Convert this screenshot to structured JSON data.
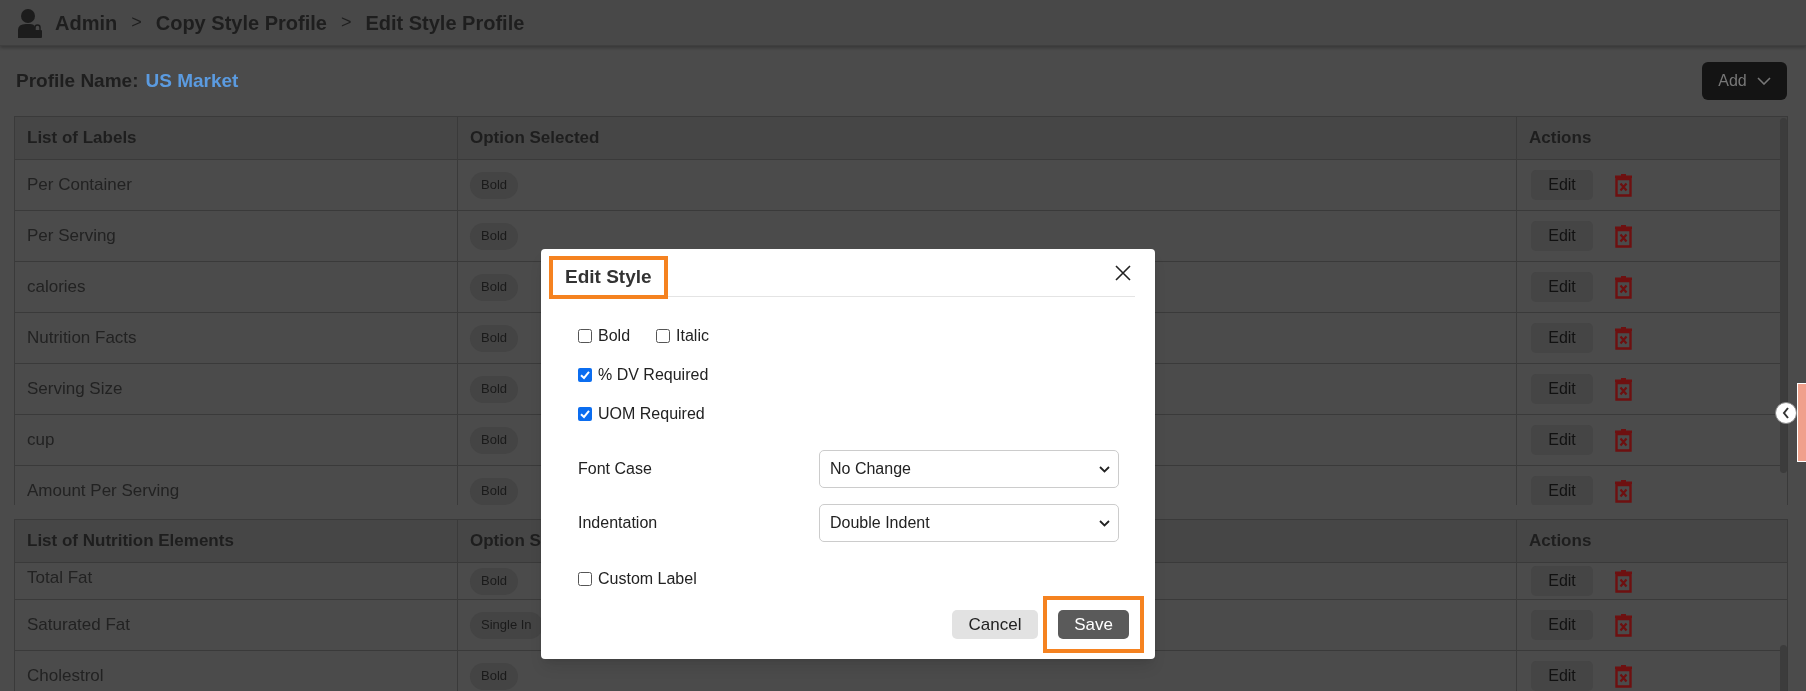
{
  "breadcrumb": [
    {
      "kind": "link",
      "text": "Admin"
    },
    {
      "kind": "separator",
      "text": ">"
    },
    {
      "kind": "link",
      "text": "Copy Style Profile"
    },
    {
      "kind": "separator",
      "text": ">"
    },
    {
      "kind": "current",
      "text": "Edit Style Profile"
    }
  ],
  "profile": {
    "label": "Profile Name:",
    "value": "US Market"
  },
  "add_button": {
    "label": "Add"
  },
  "labels_table": {
    "columns": [
      "List of Labels",
      "Option Selected",
      "Actions"
    ],
    "rows": [
      {
        "label": "Per Container",
        "options": [
          "Bold"
        ],
        "action": "Edit"
      },
      {
        "label": "Per Serving",
        "options": [
          "Bold"
        ],
        "action": "Edit"
      },
      {
        "label": "calories",
        "options": [
          "Bold"
        ],
        "action": "Edit"
      },
      {
        "label": "Nutrition Facts",
        "options": [
          "Bold"
        ],
        "action": "Edit"
      },
      {
        "label": "Serving Size",
        "options": [
          "Bold"
        ],
        "action": "Edit"
      },
      {
        "label": "cup",
        "options": [
          "Bold"
        ],
        "action": "Edit"
      },
      {
        "label": "Amount Per Serving",
        "options": [
          "Bold"
        ],
        "action": "Edit"
      }
    ]
  },
  "nutrition_table": {
    "columns": [
      "List of Nutrition Elements",
      "Option S",
      "Actions"
    ],
    "rows": [
      {
        "label": "Total Fat",
        "options": [
          "Bold"
        ],
        "action": "Edit"
      },
      {
        "label": "Saturated Fat",
        "options": [
          "Single In"
        ],
        "action": "Edit"
      },
      {
        "label": "Cholestrol",
        "options": [
          "Bold"
        ],
        "action": "Edit"
      }
    ]
  },
  "dialog": {
    "title": "Edit Style",
    "title_highlighted": true,
    "items": [
      {
        "kind": "checks",
        "options": [
          {
            "label": "Bold",
            "checked": false
          },
          {
            "label": "Italic",
            "checked": false
          }
        ]
      },
      {
        "kind": "checks",
        "options": [
          {
            "label": "% DV Required",
            "checked": true
          }
        ]
      },
      {
        "kind": "checks",
        "options": [
          {
            "label": "UOM Required",
            "checked": true
          }
        ]
      },
      {
        "kind": "select",
        "label": "Font Case",
        "value": "No Change"
      },
      {
        "kind": "select",
        "label": "Indentation",
        "value": "Double Indent"
      },
      {
        "kind": "checks",
        "options": [
          {
            "label": "Custom Label",
            "checked": false
          }
        ]
      }
    ],
    "buttons": [
      {
        "kind": "secondary",
        "label": "Cancel",
        "highlighted": false
      },
      {
        "kind": "primary",
        "label": "Save",
        "highlighted": true
      }
    ]
  }
}
